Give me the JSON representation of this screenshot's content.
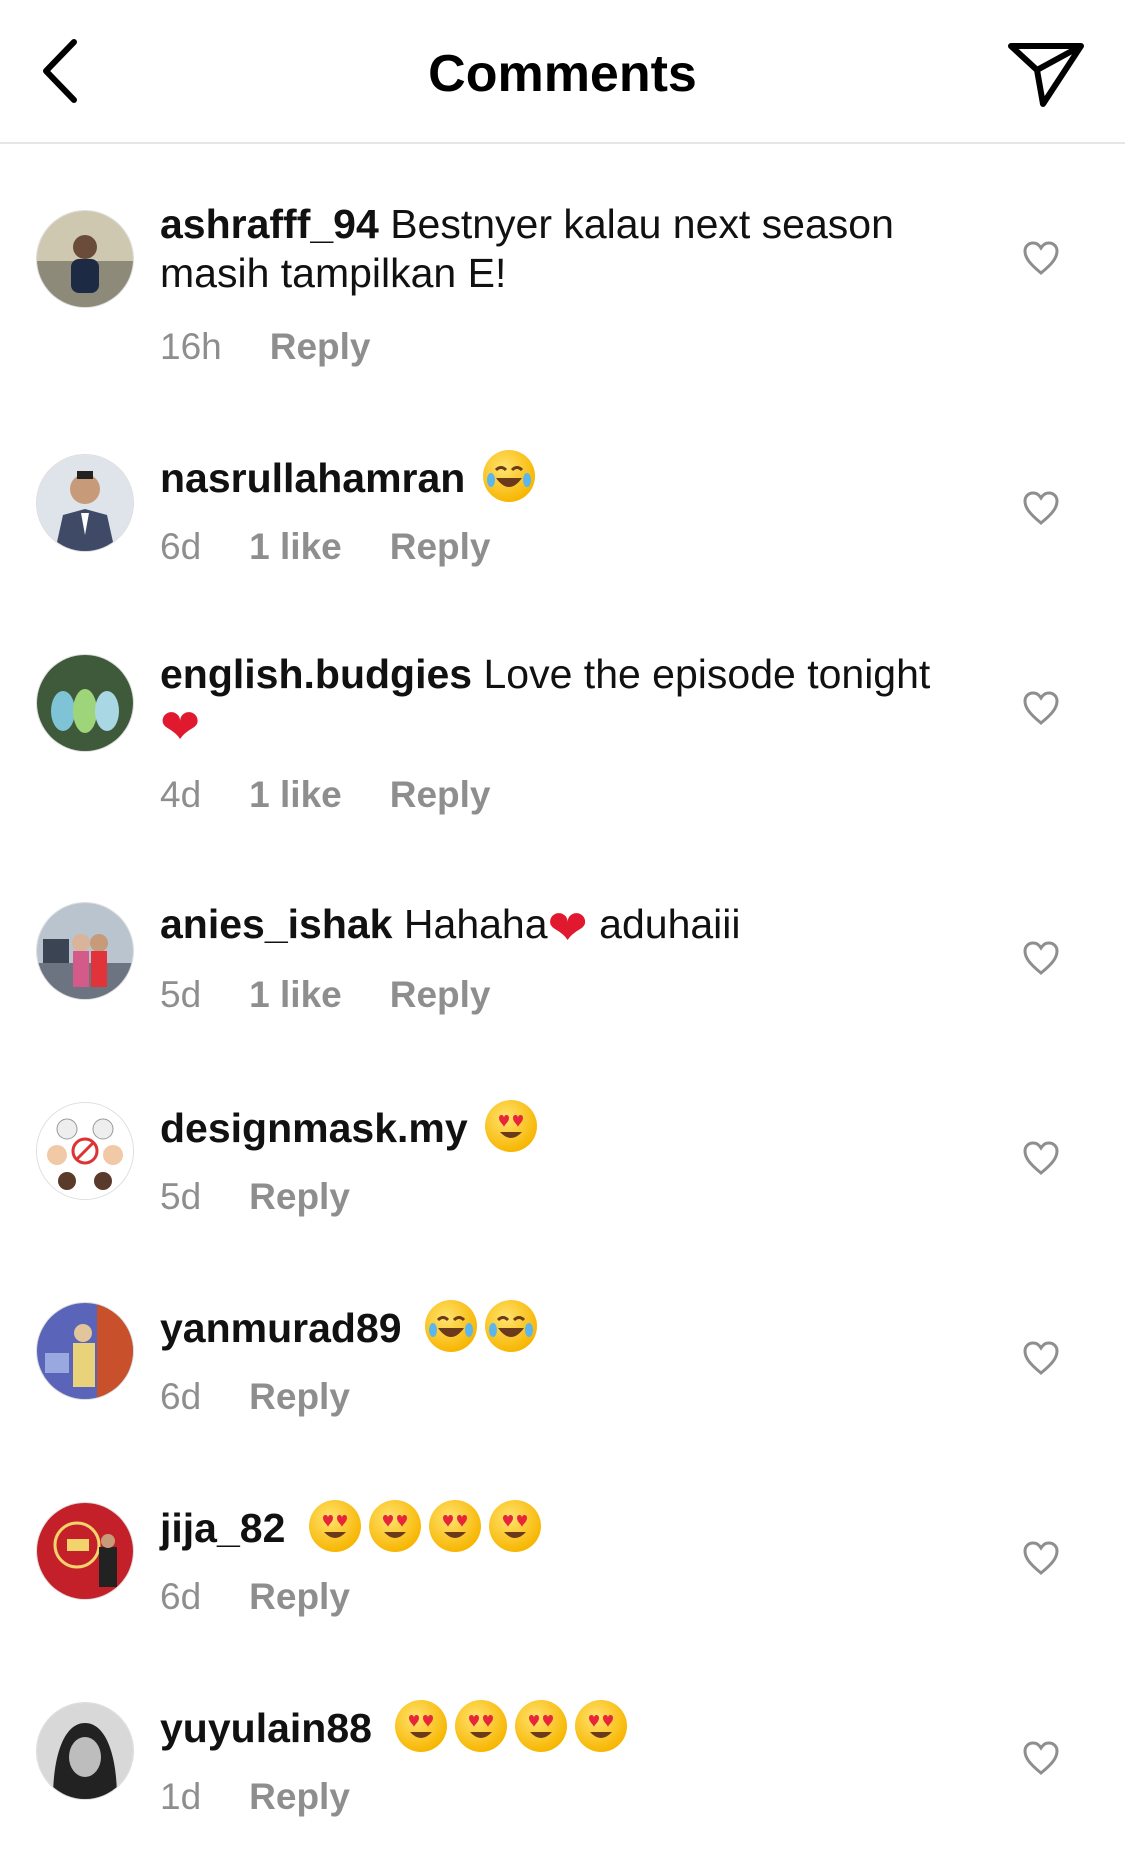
{
  "header": {
    "title": "Comments"
  },
  "comments": [
    {
      "username": "ashrafff_94",
      "text": "Bestnyer kalau next season masih tampilkan E!",
      "time": "16h",
      "likes": "",
      "reply": "Reply"
    },
    {
      "username": "nasrullahamran",
      "text": "",
      "emoji": [
        "laughing-tears"
      ],
      "time": "6d",
      "likes": "1 like",
      "reply": "Reply"
    },
    {
      "username": "english.budgies",
      "text": "Love the episode tonight",
      "emoji": [
        "red-heart"
      ],
      "time": "4d",
      "likes": "1 like",
      "reply": "Reply"
    },
    {
      "username": "anies_ishak",
      "text": "Hahaha",
      "text_after": "aduhaiii",
      "emoji": [
        "red-heart"
      ],
      "time": "5d",
      "likes": "1 like",
      "reply": "Reply"
    },
    {
      "username": "designmask.my",
      "text": "",
      "emoji": [
        "heart-eyes"
      ],
      "time": "5d",
      "likes": "",
      "reply": "Reply"
    },
    {
      "username": "yanmurad89",
      "text": "",
      "emoji": [
        "rolling-laughing",
        "rolling-laughing"
      ],
      "time": "6d",
      "likes": "",
      "reply": "Reply"
    },
    {
      "username": "jija_82",
      "text": "",
      "emoji": [
        "heart-eyes",
        "heart-eyes",
        "heart-eyes",
        "heart-eyes"
      ],
      "time": "6d",
      "likes": "",
      "reply": "Reply"
    },
    {
      "username": "yuyulain88",
      "text": "",
      "emoji": [
        "heart-eyes",
        "heart-eyes",
        "heart-eyes",
        "heart-eyes"
      ],
      "time": "1d",
      "likes": "",
      "reply": "Reply"
    }
  ],
  "icons": {
    "back": "chevron-left-icon",
    "send": "paper-plane-icon",
    "like": "heart-outline-icon"
  },
  "colors": {
    "secondary_text": "#8e8e8e",
    "red_heart": "#e0192e",
    "divider": "#e6e6e6"
  }
}
